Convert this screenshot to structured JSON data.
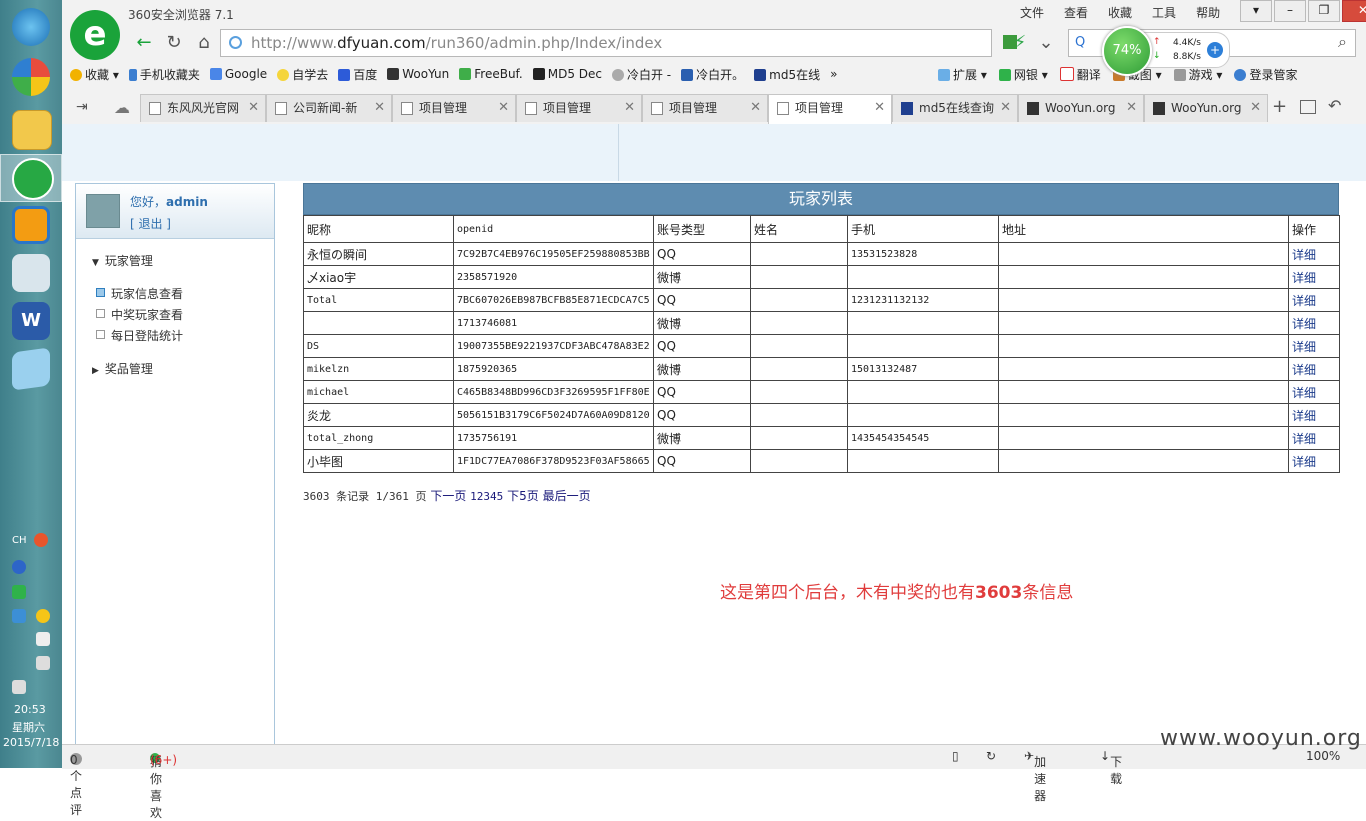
{
  "browser": {
    "app_title": "360安全浏览器 7.1",
    "menu": [
      "文件",
      "查看",
      "收藏",
      "工具",
      "帮助"
    ],
    "url_prefix": "http://www.",
    "url_domain": "dfyuan.com",
    "url_path": "/run360/admin.php/Index/index",
    "speed_percent": "74%",
    "speed_up": "4.4K/s",
    "speed_down": "8.8K/s",
    "bookmarks": [
      "收藏",
      "手机收藏夹",
      "Google",
      "自学去",
      "百度",
      "WooYun",
      "FreeBuf.",
      "MD5 Dec",
      "冷白开 -",
      "冷白开。",
      "md5在线"
    ],
    "bookmarks_right": [
      "扩展",
      "网银",
      "翻译",
      "截图",
      "游戏",
      "登录管家"
    ],
    "tabs": [
      "东风风光官网",
      "公司新闻-新",
      "项目管理",
      "项目管理",
      "项目管理",
      "项目管理",
      "md5在线查询",
      "WooYun.org",
      "WooYun.org"
    ]
  },
  "taskbar": {
    "lang": "CH",
    "time": "20:53",
    "weekday": "星期六",
    "date": "2015/7/18"
  },
  "sidebar": {
    "greeting": "您好，",
    "username": "admin",
    "logout": "[ 退出 ]",
    "section1": "玩家管理",
    "items": [
      "玩家信息查看",
      "中奖玩家查看",
      "每日登陆统计"
    ],
    "section2": "奖品管理"
  },
  "table": {
    "title": "玩家列表",
    "headers": [
      "昵称",
      "openid",
      "账号类型",
      "姓名",
      "手机",
      "地址",
      "操作"
    ],
    "rows": [
      [
        "永恒の瞬间",
        "7C92B7C4EB976C19505EF259880853BB",
        "QQ",
        "",
        "13531523828",
        "",
        "详细"
      ],
      [
        "乄xiao宇",
        "2358571920",
        "微博",
        "",
        "",
        "",
        "详细"
      ],
      [
        "Total",
        "7BC607026EB987BCFB85E871ECDCA7C5",
        "QQ",
        "",
        "1231231132132",
        "",
        "详细"
      ],
      [
        "",
        "1713746081",
        "微博",
        "",
        "",
        "",
        "详细"
      ],
      [
        "DS",
        "19007355BE9221937CDF3ABC478A83E2",
        "QQ",
        "",
        "",
        "",
        "详细"
      ],
      [
        "mikelzn",
        "1875920365",
        "微博",
        "",
        "15013132487",
        "",
        "详细"
      ],
      [
        "michael",
        "C465B8348BD996CD3F3269595F1FF80E",
        "QQ",
        "",
        "",
        "",
        "详细"
      ],
      [
        "炎龙",
        "5056151B3179C6F5024D7A60A09D8120",
        "QQ",
        "",
        "",
        "",
        "详细"
      ],
      [
        "total_zhong",
        "1735756191",
        "微博",
        "",
        "1435454354545",
        "",
        "详细"
      ],
      [
        "小毕图",
        "1F1DC77EA7086F378D9523F03AF58665",
        "QQ",
        "",
        "",
        "",
        "详细"
      ]
    ]
  },
  "pager": {
    "summary": "3603 条记录 1/361 页",
    "next": "下一页",
    "pages": "12345",
    "next5": "下5页",
    "last": "最后一页"
  },
  "note": {
    "before": "这是第四个后台，木有中奖的也有",
    "count": "3603",
    "after": "条信息"
  },
  "statusbar": {
    "comments": "0个点评",
    "guess": "猜你喜欢",
    "guess_count": "(6+)",
    "accelerator": "加速器",
    "download": "下载",
    "zoom": "100%"
  },
  "watermark": "www.wooyun.org"
}
